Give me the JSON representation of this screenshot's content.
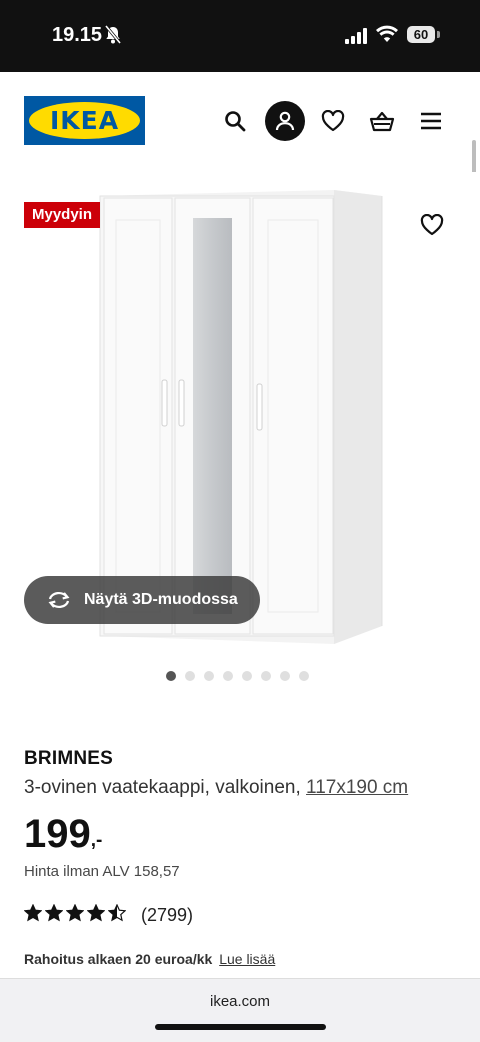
{
  "status_bar": {
    "time": "19.15",
    "battery": "60"
  },
  "header": {
    "logo_text": "IKEA",
    "icons": [
      "search-icon",
      "user-icon",
      "heart-icon",
      "basket-icon",
      "menu-icon"
    ]
  },
  "gallery": {
    "badge": "Myydyin",
    "view_3d_label": "Näytä 3D-muodossa",
    "image_count": 8,
    "active_image": 1
  },
  "product": {
    "name": "BRIMNES",
    "description": "3-ovinen vaatekaappi, valkoinen,",
    "size_link": "117x190 cm",
    "price_integer": "199",
    "price_suffix": ",-",
    "price_excl_vat": "Hinta ilman ALV 158,57",
    "rating_stars": 4.5,
    "review_count": "(2799)",
    "financing_text": "Rahoitus alkaen 20 euroa/kk",
    "financing_link": "Lue lisää"
  },
  "browser": {
    "url": "ikea.com"
  },
  "colors": {
    "ikea_blue": "#0058a3",
    "ikea_yellow": "#ffdb00",
    "badge_red": "#cc0008"
  }
}
